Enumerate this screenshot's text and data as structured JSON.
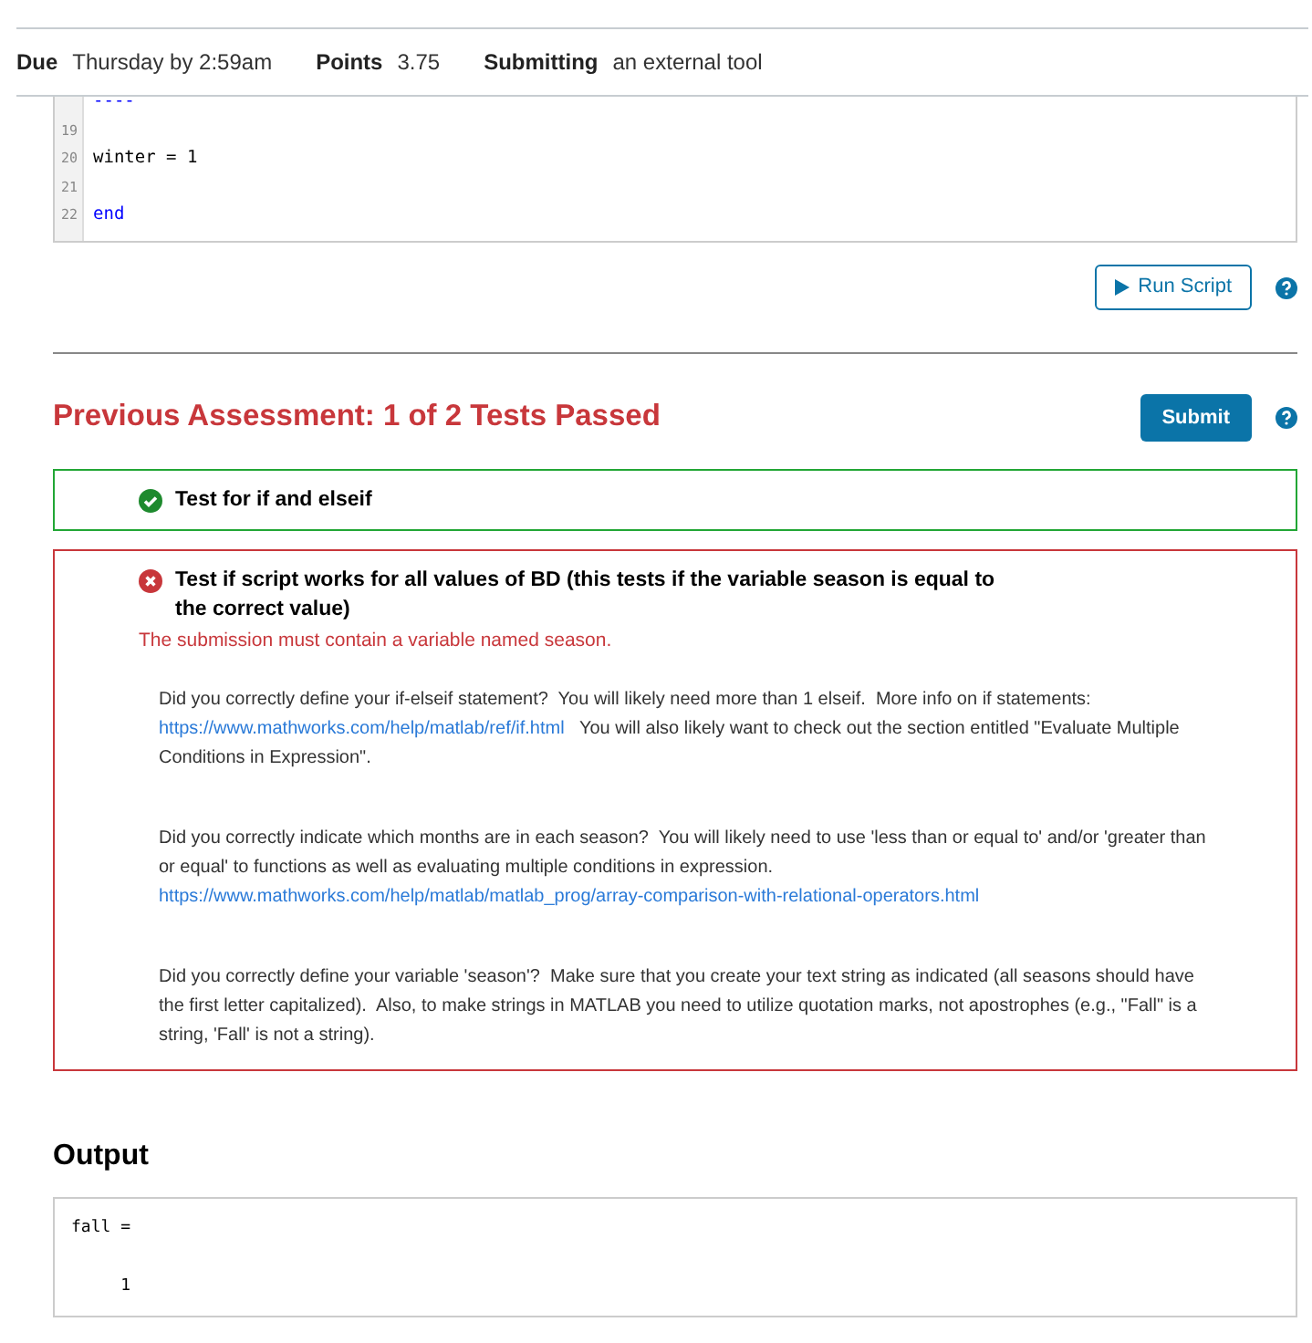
{
  "header": [
    {
      "label": "Due",
      "value": "Thursday by 2:59am"
    },
    {
      "label": "Points",
      "value": "3.75"
    },
    {
      "label": "Submitting",
      "value": "an external tool"
    }
  ],
  "code": {
    "lines": [
      {
        "text": "----",
        "kind": "keyword"
      },
      {
        "number": "19"
      },
      {
        "number": "20",
        "text": "winter = 1",
        "kind": "plain"
      },
      {
        "number": "21"
      },
      {
        "number": "22",
        "text": "end",
        "kind": "keyword"
      }
    ]
  },
  "run_button": "Run Script",
  "assessment": {
    "title": "Previous Assessment: 1 of 2 Tests Passed",
    "submit": "Submit",
    "tests": [
      {
        "title": "Test for if and elseif",
        "passed": true
      },
      {
        "title": "Test if script works for all values of BD (this tests if the variable season is equal to the correct value)",
        "passed": false,
        "message": "The submission must contain a variable named season.",
        "feedback": [
          [
            {
              "kind": "text",
              "text": "Did you correctly define your if-elseif statement?  You will likely need more than 1 elseif.  More info on if statements: "
            },
            {
              "kind": "link",
              "text": "https://www.mathworks.com/help/matlab/ref/if.html"
            },
            {
              "kind": "text",
              "text": "   You will also likely want to check out the section entitled \"Evaluate Multiple Conditions in Expression\"."
            }
          ],
          [
            {
              "kind": "text",
              "text": "Did you correctly indicate which months are in each season?  You will likely need to use 'less than or equal to' and/or 'greater than or equal' to functions as well as evaluating multiple conditions in expression. "
            },
            {
              "kind": "link",
              "text": "https://www.mathworks.com/help/matlab/matlab_prog/array-comparison-with-relational-operators.html"
            }
          ],
          [
            {
              "kind": "text",
              "text": "Did you correctly define your variable 'season'?  Make sure that you create your text string as indicated (all seasons should have the first letter capitalized).  Also, to make strings in MATLAB you need to utilize quotation marks, not apostrophes (e.g., \"Fall\" is a string, 'Fall' is not a string)."
            }
          ]
        ]
      }
    ]
  },
  "output": {
    "title": "Output",
    "lines": [
      "fall =",
      "     1"
    ]
  }
}
